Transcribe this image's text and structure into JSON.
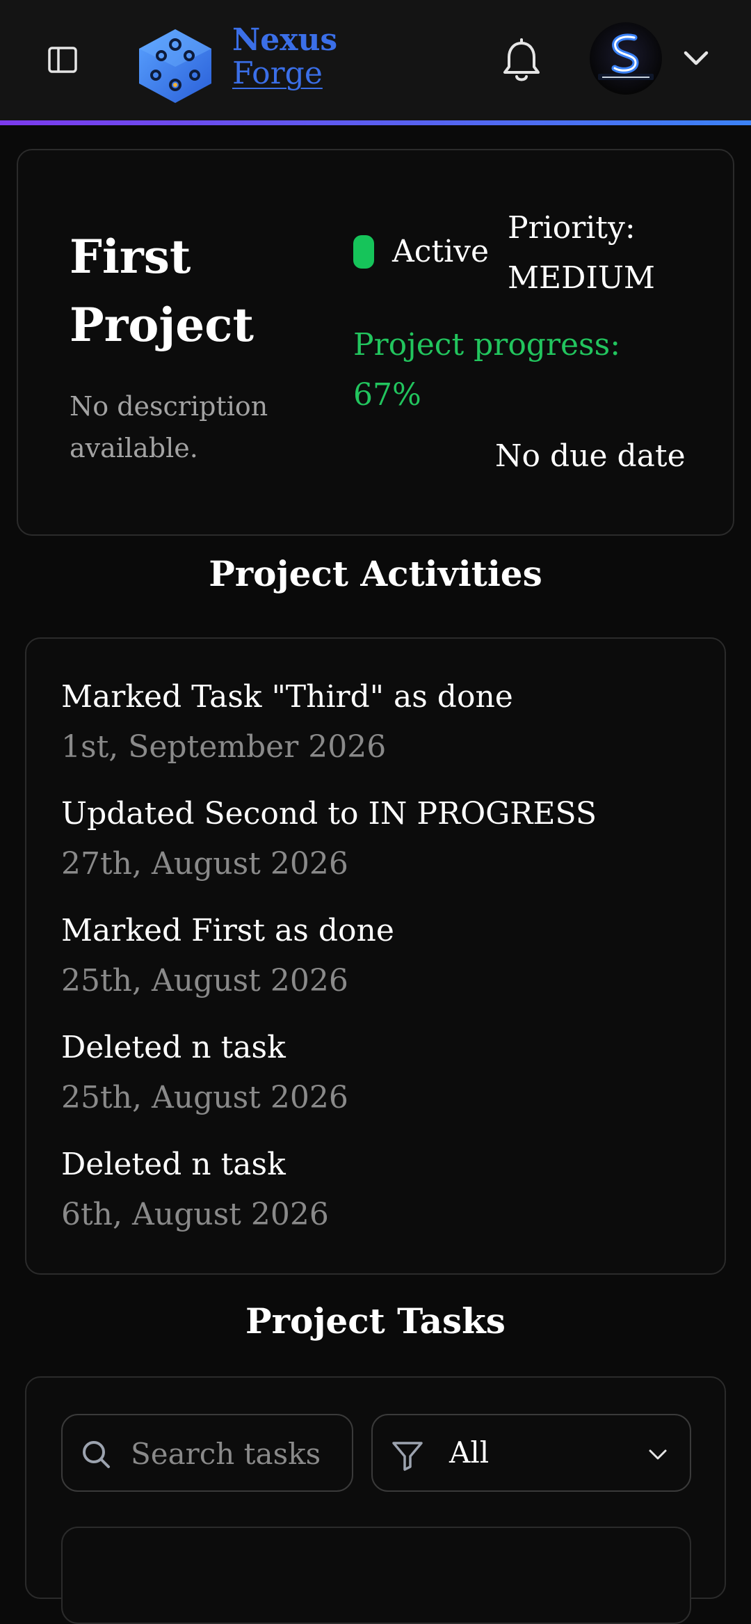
{
  "header": {
    "brand_line1": "Nexus",
    "brand_line2": "Forge",
    "accent_colors": [
      "#7c3aed",
      "#3b82f6"
    ],
    "icons": {
      "sidebar": "sidebar-toggle-icon",
      "logo": "hexagon-dice-logo",
      "notifications": "bell-icon",
      "avatar": "user-avatar",
      "menu": "chevron-down-icon"
    }
  },
  "project": {
    "title": "First Project",
    "description": "No description available.",
    "status": "Active",
    "status_color": "#16c45a",
    "priority": "Priority: MEDIUM",
    "progress_text": "Project progress: 67%",
    "progress_value": 67,
    "progress_color": "#22c55e",
    "due_date": "No due date"
  },
  "activities": {
    "title": "Project Activities",
    "items": [
      {
        "text": "Marked Task \"Third\" as done",
        "date": "1st, September 2026"
      },
      {
        "text": "Updated Second to IN PROGRESS",
        "date": "27th, August 2026"
      },
      {
        "text": "Marked First as done",
        "date": "25th, August 2026"
      },
      {
        "text": "Deleted n task",
        "date": "25th, August 2026"
      },
      {
        "text": "Deleted n task",
        "date": "6th, August 2026"
      }
    ]
  },
  "tasks": {
    "title": "Project Tasks",
    "search_placeholder": "Search tasks",
    "search_value": "",
    "filter_selected": "All",
    "icons": {
      "search": "search-icon",
      "filter": "filter-icon",
      "dropdown": "chevron-down-icon"
    }
  }
}
